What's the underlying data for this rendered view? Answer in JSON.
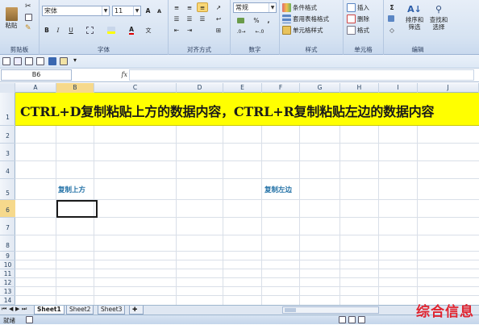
{
  "ribbon": {
    "clipboard": {
      "paste": "粘贴",
      "label": "剪贴板"
    },
    "font": {
      "name": "宋体",
      "size": "11",
      "label": "字体"
    },
    "align": {
      "label": "对齐方式"
    },
    "number": {
      "format": "常规",
      "percent": "%",
      "comma": ",",
      "label": "数字"
    },
    "styles": {
      "cond": "条件格式",
      "table": "套用表格格式",
      "cell": "单元格样式",
      "label": "样式"
    },
    "cells": {
      "insert": "插入",
      "delete": "删除",
      "format": "格式",
      "label": "单元格"
    },
    "edit": {
      "sort": "排序和筛选",
      "find": "查找和选择",
      "label": "编辑"
    }
  },
  "formula_bar": {
    "name_box": "B6",
    "fx": "fx",
    "content": ""
  },
  "columns": [
    "A",
    "B",
    "C",
    "D",
    "E",
    "F",
    "G",
    "H",
    "I",
    "J"
  ],
  "rows": [
    "1",
    "2",
    "3",
    "4",
    "5",
    "6",
    "7",
    "8",
    "9",
    "10",
    "11",
    "12",
    "13",
    "14"
  ],
  "cells": {
    "A1": "CTRL+D复制粘贴上方的数据内容，CTRL+R复制粘贴左边的数据内容",
    "B5": "复制上方",
    "F5": "复制左边"
  },
  "sheets": [
    "Sheet1",
    "Sheet2",
    "Sheet3"
  ],
  "status": {
    "ready": "就绪"
  },
  "watermark": "综合信息",
  "colors": {
    "banner": "#ffff00",
    "label_text": "#1f6fa5",
    "watermark": "#e0242f"
  }
}
